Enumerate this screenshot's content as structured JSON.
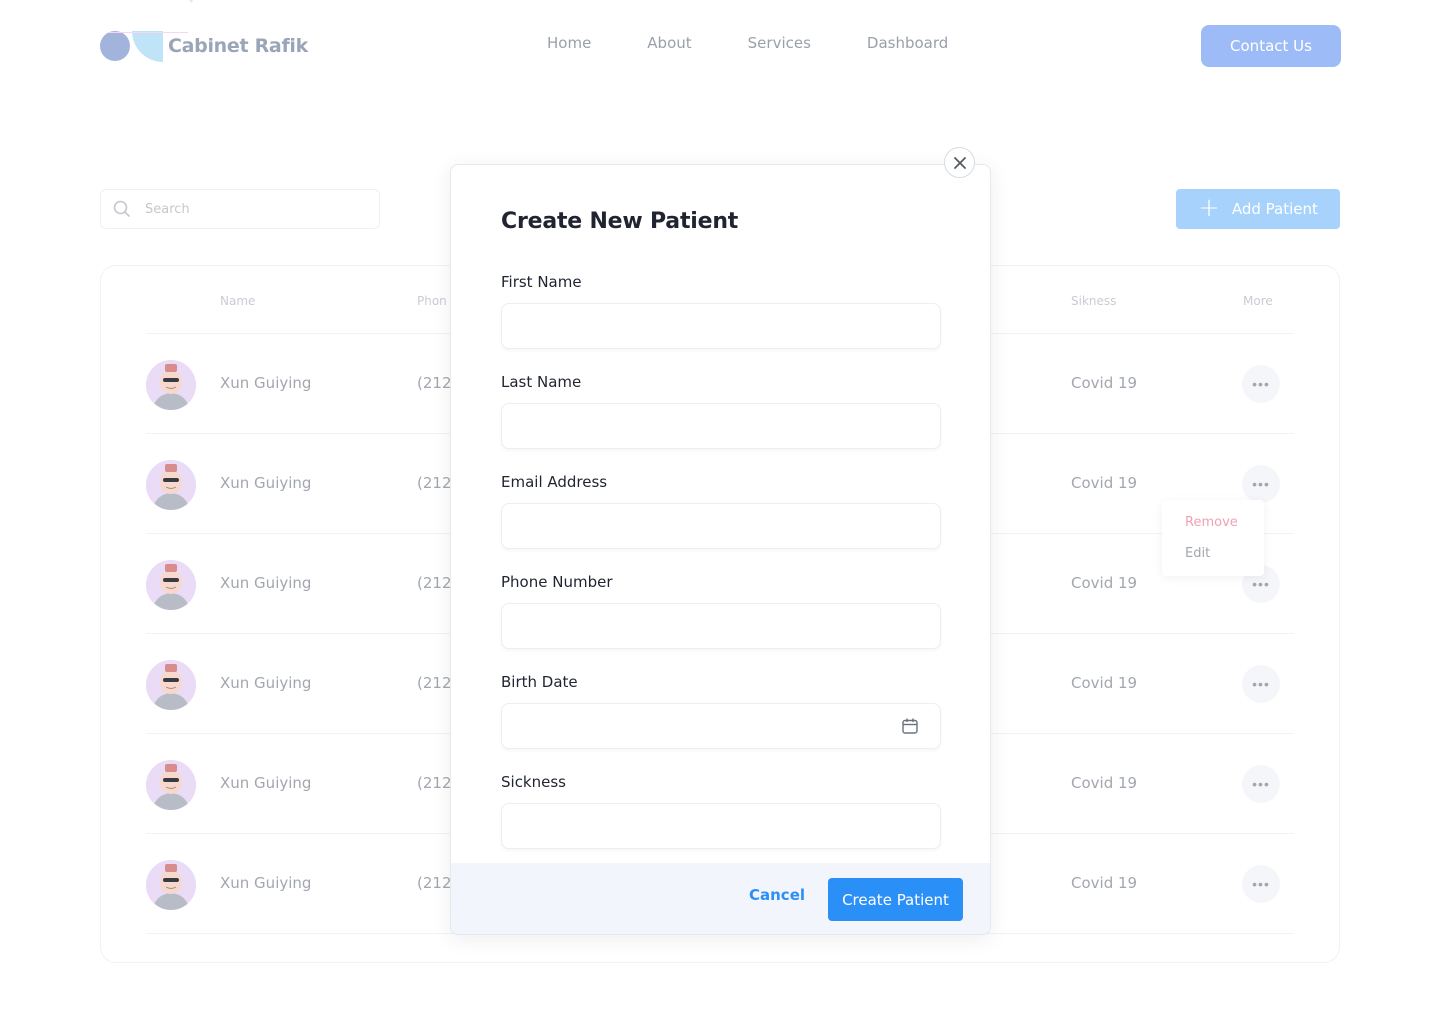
{
  "brand": {
    "name": "Cabinet Rafik",
    "mark": "*",
    "colors": {
      "primary": "#2a8ff7",
      "contact": "#9dbcf7",
      "add": "#a6d2fb",
      "danger": "#f0a0b4"
    }
  },
  "nav": {
    "items": [
      "Home",
      "About",
      "Services",
      "Dashboard"
    ],
    "contact_label": "Contact Us"
  },
  "search": {
    "placeholder": "Search"
  },
  "add_patient_label": "Add Patient",
  "table": {
    "headers": {
      "name": "Name",
      "phone": "Phon",
      "sickness": "Sikness",
      "more": "More"
    },
    "rows": [
      {
        "name": "Xun Guiying",
        "phone": "(212)",
        "sickness": "Covid 19"
      },
      {
        "name": "Xun Guiying",
        "phone": "(212)",
        "sickness": "Covid 19"
      },
      {
        "name": "Xun Guiying",
        "phone": "(212)",
        "sickness": "Covid 19"
      },
      {
        "name": "Xun Guiying",
        "phone": "(212)",
        "sickness": "Covid 19"
      },
      {
        "name": "Xun Guiying",
        "phone": "(212)",
        "sickness": "Covid 19"
      },
      {
        "name": "Xun Guiying",
        "phone": "(212)",
        "sickness": "Covid 19"
      }
    ]
  },
  "row_menu": {
    "remove": "Remove",
    "edit": "Edit"
  },
  "modal": {
    "title": "Create New Patient",
    "fields": {
      "first_name": {
        "label": "First Name",
        "value": ""
      },
      "last_name": {
        "label": "Last Name",
        "value": ""
      },
      "email": {
        "label": "Email Address",
        "value": ""
      },
      "phone": {
        "label": "Phone Number",
        "value": ""
      },
      "birth_date": {
        "label": "Birth Date",
        "value": "",
        "icon": "calendar-icon"
      },
      "sickness": {
        "label": "Sickness",
        "value": ""
      }
    },
    "cancel_label": "Cancel",
    "submit_label": "Create Patient",
    "close_icon": "close-icon"
  }
}
